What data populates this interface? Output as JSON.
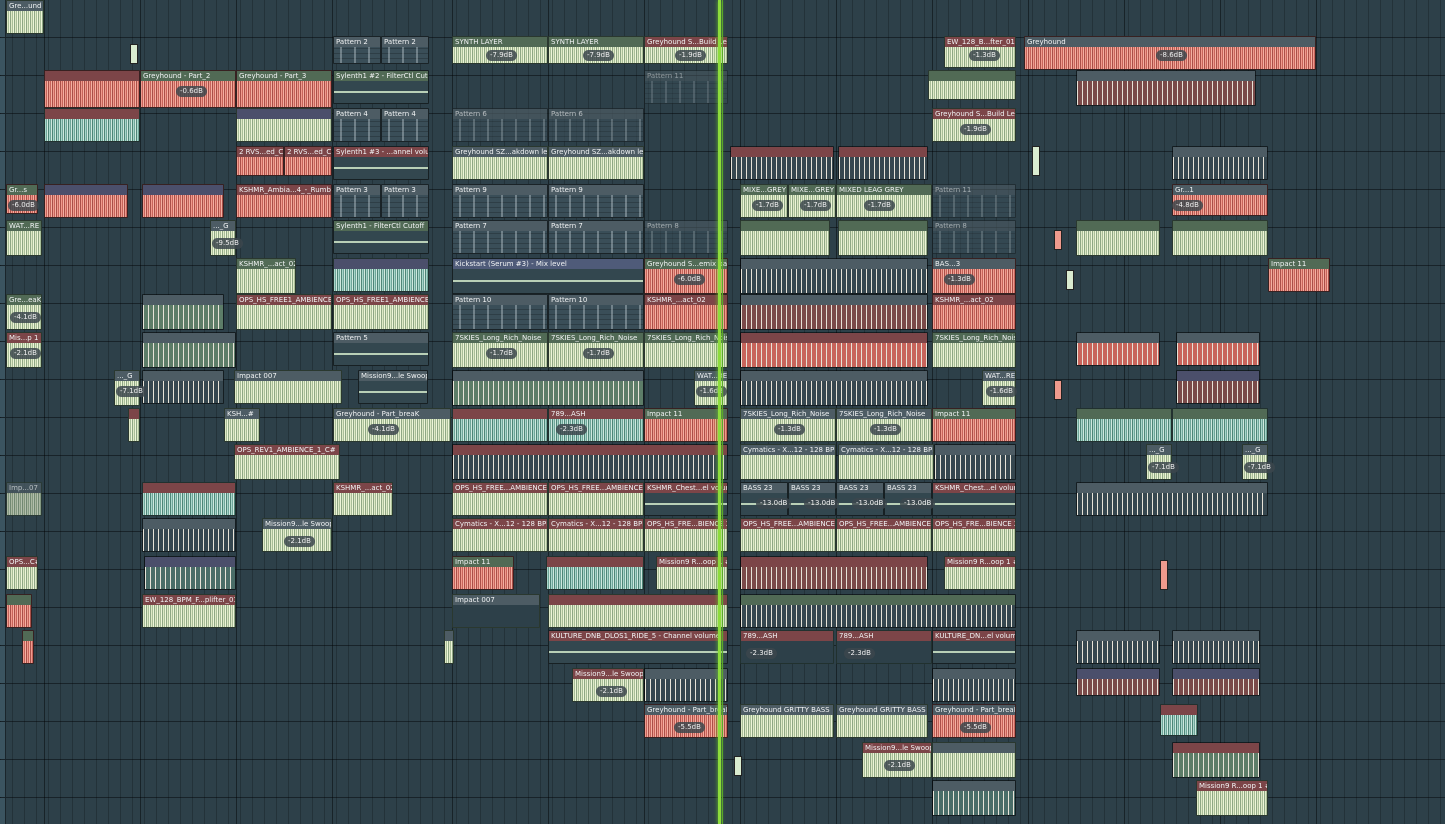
{
  "playlist": {
    "clips": [
      {
        "label": "Gre...und"
      },
      {
        "label": "Pattern 2"
      },
      {
        "label": "Pattern 2"
      },
      {
        "label": "SYNTH LAYER"
      },
      {
        "label": "SYNTH LAYER"
      },
      {
        "label": "Greyhound S...Build Lead"
      },
      {
        "label": "EW_128_B...fter_010"
      },
      {
        "label": "Greyhound"
      },
      {
        "label": "Greyhound - Part_2"
      },
      {
        "label": "Greyhound - Part_3"
      },
      {
        "label": "Sylenth1 #2 - FilterCtl Cutoff"
      },
      {
        "label": "Pattern 11"
      },
      {
        "label": "Pattern 4"
      },
      {
        "label": "Pattern 4"
      },
      {
        "label": "Pattern 6"
      },
      {
        "label": "Pattern 6"
      },
      {
        "label": "Greyhound S...Build Lead"
      },
      {
        "label": "2 RVS...ed_C"
      },
      {
        "label": "2 RVS...ed_C#"
      },
      {
        "label": "Sylenth1 #3 - ...annel volume"
      },
      {
        "label": "Greyhound SZ...akdown lead"
      },
      {
        "label": "Greyhound SZ...akdown lead"
      },
      {
        "label": "Gr...s"
      },
      {
        "label": "KSHMR_Ambia...4_-_Rumble"
      },
      {
        "label": "Pattern 3"
      },
      {
        "label": "Pattern 3"
      },
      {
        "label": "Pattern 9"
      },
      {
        "label": "Pattern 9"
      },
      {
        "label": "MIXE...GREY"
      },
      {
        "label": "MIXE...GREY"
      },
      {
        "label": "MIXED LEAG GREY"
      },
      {
        "label": "Pattern 11"
      },
      {
        "label": "Gr...1"
      },
      {
        "label": "WAT...RE"
      },
      {
        "label": "..._G"
      },
      {
        "label": "Sylenth1 - FilterCtl Cutoff"
      },
      {
        "label": "Pattern 7"
      },
      {
        "label": "Pattern 7"
      },
      {
        "label": "Pattern 8"
      },
      {
        "label": "Pattern 8"
      },
      {
        "label": "KSHMR_...act_02"
      },
      {
        "label": "Kickstart (Serum #3) - Mix level"
      },
      {
        "label": "Greyhound S...emix bass"
      },
      {
        "label": "BAS...3"
      },
      {
        "label": "Impact 11"
      },
      {
        "label": "Gre...eaK"
      },
      {
        "label": "OPS_HS_FREE1_AMBIENCE"
      },
      {
        "label": "OPS_HS_FREE1_AMBIENCE 2 A"
      },
      {
        "label": "Pattern 10"
      },
      {
        "label": "Pattern 10"
      },
      {
        "label": "KSHMR_...act_02"
      },
      {
        "label": "KSHMR_...act_02"
      },
      {
        "label": "Mis...p 1"
      },
      {
        "label": "Pattern 5"
      },
      {
        "label": "7SKIES_Long_Rich_Noise"
      },
      {
        "label": "7SKIES_Long_Rich_Noise"
      },
      {
        "label": "7SKIES_Long_Rich_Noise"
      },
      {
        "label": "7SKIES_Long_Rich_Noise"
      },
      {
        "label": "..._G"
      },
      {
        "label": "Impact 007"
      },
      {
        "label": "Mission9...le Swoop 1"
      },
      {
        "label": "WAT...RE"
      },
      {
        "label": "WAT...RE"
      },
      {
        "label": "KSH...#"
      },
      {
        "label": "Greyhound - Part_breaK"
      },
      {
        "label": "789...ASH"
      },
      {
        "label": "Impact 11"
      },
      {
        "label": "7SKIES_Long_Rich_Noise"
      },
      {
        "label": "7SKIES_Long_Rich_Noise"
      },
      {
        "label": "Impact 11"
      },
      {
        "label": "OPS_REV1_AMBIENCE_1_C#"
      },
      {
        "label": "Cymatics - X...12 - 128 BPM"
      },
      {
        "label": "Cymatics - X...12 - 128 BPM"
      },
      {
        "label": "..._G"
      },
      {
        "label": "..._G"
      },
      {
        "label": "Imp...07"
      },
      {
        "label": "KSHMR_...act_02"
      },
      {
        "label": "OPS_HS_FREE...AMBIENCE 2 A"
      },
      {
        "label": "OPS_HS_FREE...AMBIENCE 2 A"
      },
      {
        "label": "KSHMR_Chest...el volume"
      },
      {
        "label": "BASS 23"
      },
      {
        "label": "BASS 23"
      },
      {
        "label": "BASS 23"
      },
      {
        "label": "BASS 23"
      },
      {
        "label": "KSHMR_Chest...el volume"
      },
      {
        "label": "Mission9...le Swoop 1"
      },
      {
        "label": "Cymatics - X...12 - 128 BPM"
      },
      {
        "label": "Cymatics - X...12 - 128 BPM"
      },
      {
        "label": "OPS_HS_FRE...BIENCE 2 A"
      },
      {
        "label": "OPS_HS_FREE...AMBIENCE 2 A"
      },
      {
        "label": "OPS_HS_FREE...AMBIENCE 2 A"
      },
      {
        "label": "OPS_HS_FRE...BIENCE 2 A"
      },
      {
        "label": "OPS...C#"
      },
      {
        "label": "Impact 11"
      },
      {
        "label": "Mission9 R...oop 1 #2"
      },
      {
        "label": "Mission9 R...oop 1 #2"
      },
      {
        "label": "EW_128_BPM_F...plifter_010"
      },
      {
        "label": "Impact 007"
      },
      {
        "label": "KULTURE_DNB_DLOS1_RIDE_5 - Channel volume"
      },
      {
        "label": "789...ASH"
      },
      {
        "label": "789...ASH"
      },
      {
        "label": "KULTURE_DN...el volume"
      },
      {
        "label": "Mission9...le Swoop 1"
      },
      {
        "label": "Greyhound - Part_breaK"
      },
      {
        "label": "Greyhound GRITTY BASS"
      },
      {
        "label": "Greyhound GRITTY BASS"
      },
      {
        "label": "Greyhound - Part_breaK"
      },
      {
        "label": "Mission9...le Swoop 1"
      },
      {
        "label": "Mission9 R...oop 1 #2"
      }
    ],
    "volumes": [
      "-7.9dB",
      "-7.9dB",
      "-1.9dB",
      "-1.3dB",
      "-8.6dB",
      "-0.6dB",
      "-1.9dB",
      "-6.0dB",
      "-1.7dB",
      "-1.7dB",
      "-1.7dB",
      "-4.8dB",
      "-9.5dB",
      "-6.0dB",
      "-1.3dB",
      "-4.1dB",
      "-2.1dB",
      "-1.7dB",
      "-1.7dB",
      "-7.1dB",
      "-1.6dB",
      "-1.6dB",
      "-4.1dB",
      "-2.3dB",
      "-1.3dB",
      "-1.3dB",
      "-7.1dB",
      "-7.1dB",
      "-13.0dB",
      "-13.0dB",
      "-13.0dB",
      "-13.0dB",
      "-2.1dB",
      "-2.3dB",
      "-2.3dB",
      "-2.1dB",
      "-5.5dB",
      "-5.5dB",
      "-2.1dB"
    ]
  },
  "colors": {
    "background": "#2d4049",
    "playhead": "#8ddc3c",
    "wave_green": "#dfe9c7",
    "wave_red": "#ef9a8d",
    "wave_teal": "#a9d6cb"
  }
}
